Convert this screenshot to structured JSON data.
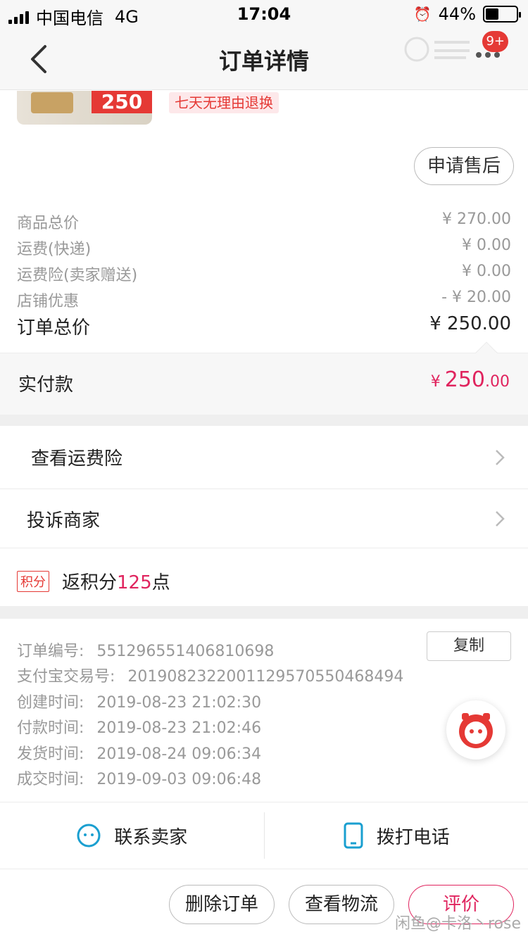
{
  "status_bar": {
    "carrier": "中国电信",
    "network": "4G",
    "time": "17:04",
    "battery_percent_text": "44%",
    "battery_level": 0.44
  },
  "nav": {
    "title": "订单详情",
    "badge": "9+"
  },
  "product": {
    "promo_text": "250",
    "return_tag": "七天无理由退换"
  },
  "after_sale_label": "申请售后",
  "prices": [
    {
      "label": "商品总价",
      "value": "¥ 270.00"
    },
    {
      "label": "运费(快递)",
      "value": "¥ 0.00"
    },
    {
      "label": "运费险(卖家赠送)",
      "value": "¥ 0.00"
    },
    {
      "label": "店铺优惠",
      "value": "- ¥ 20.00"
    }
  ],
  "order_total": {
    "label": "订单总价",
    "value": "¥ 250.00"
  },
  "payment": {
    "label": "实付款",
    "yen": "¥",
    "integer": "250",
    "cents": ".00"
  },
  "links": [
    {
      "label": "查看运费险"
    },
    {
      "label": "投诉商家"
    }
  ],
  "points": {
    "tag": "积分",
    "prefix": "返积分",
    "number": "125",
    "suffix": "点"
  },
  "order_info": [
    {
      "key": "订单编号:",
      "value": "551296551406810698"
    },
    {
      "key": "支付宝交易号:",
      "value": "2019082322001129570550468494"
    },
    {
      "key": "创建时间:",
      "value": "2019-08-23 21:02:30"
    },
    {
      "key": "付款时间:",
      "value": "2019-08-23 21:02:46"
    },
    {
      "key": "发货时间:",
      "value": "2019-08-24 09:06:34"
    },
    {
      "key": "成交时间:",
      "value": "2019-09-03 09:06:48"
    }
  ],
  "copy_label": "复制",
  "contact": {
    "seller": "联系卖家",
    "phone": "拨打电话"
  },
  "actions": {
    "delete": "删除订单",
    "logistics": "查看物流",
    "review": "评价"
  },
  "watermark": "闲鱼@卡洛丶rose",
  "colors": {
    "accent": "#e0245e",
    "contact_icon": "#1a9fd0"
  }
}
